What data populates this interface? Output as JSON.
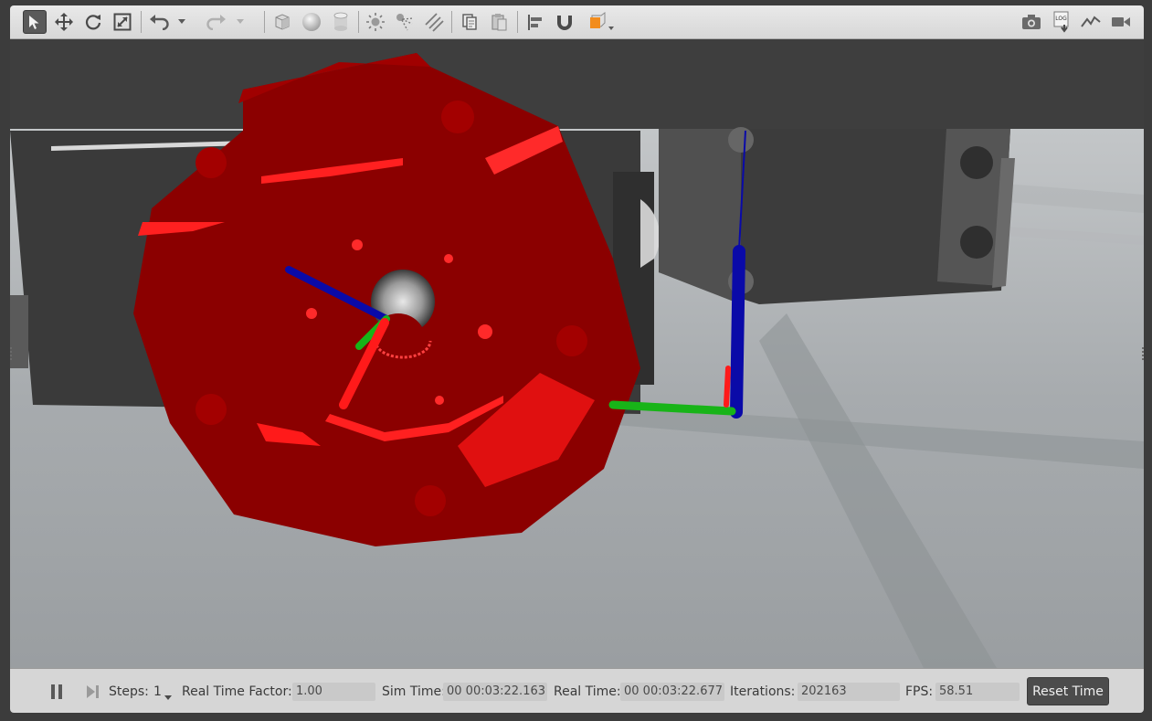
{
  "toolbar": {
    "left_tools": [
      {
        "name": "select-mode-icon",
        "active": true
      },
      {
        "name": "translate-mode-icon"
      },
      {
        "name": "rotate-mode-icon"
      },
      {
        "name": "scale-mode-icon"
      },
      {
        "name": "undo-icon"
      },
      {
        "name": "undo-history-chevron-icon"
      },
      {
        "name": "redo-icon"
      },
      {
        "name": "redo-history-chevron-icon"
      },
      {
        "name": "box-shape-icon"
      },
      {
        "name": "sphere-shape-icon"
      },
      {
        "name": "cylinder-shape-icon"
      },
      {
        "name": "point-light-icon"
      },
      {
        "name": "spot-light-icon"
      },
      {
        "name": "directional-light-icon"
      },
      {
        "name": "copy-icon"
      },
      {
        "name": "paste-icon"
      },
      {
        "name": "align-icon"
      },
      {
        "name": "snap-magnet-icon"
      },
      {
        "name": "view-angle-icon"
      }
    ],
    "right_tools": [
      {
        "name": "screenshot-camera-icon"
      },
      {
        "name": "log-recorder-icon",
        "badge": "LOG"
      },
      {
        "name": "plot-icon"
      },
      {
        "name": "video-recorder-icon"
      }
    ]
  },
  "colors": {
    "wheel": "#8b0000",
    "axis_x": "#ff1a1a",
    "axis_y": "#18b418",
    "axis_z": "#0a0aa8",
    "ground": "#9ea3a6",
    "chassis": "#3d3d3d"
  },
  "bottom_bar": {
    "pause_icon": "pause-icon",
    "step_icon": "step-forward-icon",
    "steps_label": "Steps:",
    "steps_value": "1",
    "real_time_factor_label": "Real Time Factor:",
    "real_time_factor_value": "1.00",
    "sim_time_label": "Sim Time:",
    "sim_time_value": "00 00:03:22.163",
    "real_time_label": "Real Time:",
    "real_time_value": "00 00:03:22.677",
    "iterations_label": "Iterations:",
    "iterations_value": "202163",
    "fps_label": "FPS:",
    "fps_value": "58.51",
    "reset_time_label": "Reset Time"
  }
}
